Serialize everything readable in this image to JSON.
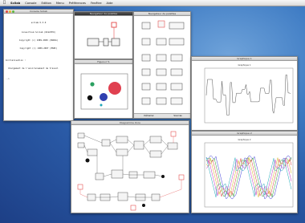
{
  "menubar": {
    "app_name": "Scilab",
    "items": [
      "Console",
      "Edition",
      "Menu",
      "Préférences",
      "Fenêtre",
      "Aide"
    ]
  },
  "console": {
    "title": "Console Scilab",
    "banner": [
      "scilab-5.3.0",
      "Consortium Scilab (DIGITEO)",
      "Copyright (c) 1989-2009 (INRIA)",
      "Copyright (c) 1989-2007 (ENPC)"
    ],
    "startup": [
      "Initialisation :",
      "  Chargement de l'environnement de travail"
    ],
    "prompt": "-->"
  },
  "palette_list": {
    "title": "Navigateur de palettes"
  },
  "palette_blocks": {
    "title": "Navigateur de palettes",
    "footer": [
      "Démarrer",
      "Sources"
    ]
  },
  "small_diagram": {
    "title": "Figure n°1"
  },
  "scope_top": {
    "title": "Graphique 1",
    "plot_title": "Graphique 1"
  },
  "scope_bottom": {
    "title": "Graphique 2",
    "plot_title": "Graphique 2"
  },
  "diagram": {
    "title": "Diagramme Xcos"
  },
  "colors": {
    "red_block": "#e03030",
    "scope_blue": "#3a3ad8",
    "scope_green": "#2aa02a",
    "scope_red": "#d83a3a",
    "scope_yellow": "#d4b21a",
    "scope_magenta": "#c030c0",
    "scope_cyan": "#1aa6b8"
  }
}
